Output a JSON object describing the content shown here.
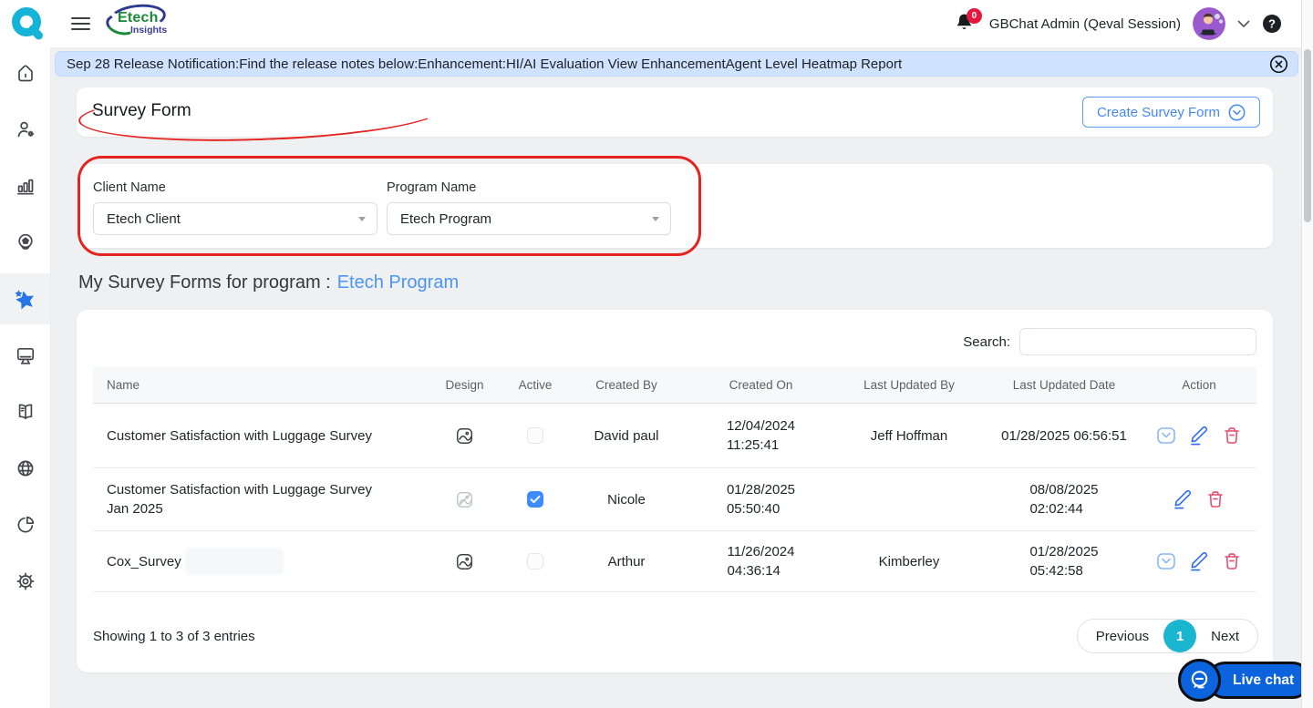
{
  "app": {
    "brand": {
      "line1": "Etech",
      "line2": "Insights"
    },
    "notification_badge": "0",
    "user_name": "GBChat Admin (Qeval Session)"
  },
  "banner": {
    "text": "Sep 28 Release Notification:Find the release notes below:Enhancement:HI/AI Evaluation View EnhancementAgent Level Heatmap Report"
  },
  "page": {
    "title": "Survey Form",
    "create_button": "Create Survey Form"
  },
  "filters": {
    "client": {
      "label": "Client Name",
      "value": "Etech Client"
    },
    "program": {
      "label": "Program Name",
      "value": "Etech Program"
    }
  },
  "section_heading": {
    "prefix": "My Survey Forms for program :",
    "program": "Etech Program"
  },
  "table": {
    "search_label": "Search:",
    "search_value": "",
    "columns": [
      "Name",
      "Design",
      "Active",
      "Created By",
      "Created On",
      "Last Updated By",
      "Last Updated Date",
      "Action"
    ],
    "rows": [
      {
        "name": "Customer Satisfaction with Luggage Survey",
        "active": false,
        "created_by": "David paul",
        "created_on_line1": "12/04/2024",
        "created_on_line2": "11:25:41",
        "last_updated_by": "Jeff Hoffman",
        "last_updated_line1": "01/28/2025 06:56:51",
        "last_updated_line2": "",
        "actions": [
          "mail",
          "edit",
          "delete"
        ],
        "design_disabled": false
      },
      {
        "name": "Customer Satisfaction with Luggage Survey Jan 2025",
        "active": true,
        "created_by": "Nicole",
        "created_on_line1": "01/28/2025",
        "created_on_line2": "05:50:40",
        "last_updated_by": "",
        "last_updated_line1": "08/08/2025",
        "last_updated_line2": "02:02:44",
        "actions": [
          "edit",
          "delete"
        ],
        "design_disabled": true
      },
      {
        "name": "Cox_Survey",
        "active": false,
        "created_by": "Arthur",
        "created_on_line1": "11/26/2024",
        "created_on_line2": "04:36:14",
        "last_updated_by": "Kimberley",
        "last_updated_line1": "01/28/2025",
        "last_updated_line2": "05:42:58",
        "actions": [
          "mail",
          "edit",
          "delete"
        ],
        "design_disabled": false
      }
    ],
    "footer": "Showing 1 to 3 of 3 entries"
  },
  "pagination": {
    "previous": "Previous",
    "current_page": "1",
    "next": "Next"
  },
  "live_chat": {
    "label": "Live chat"
  },
  "sidebar": {
    "items": [
      {
        "icon": "home-icon",
        "active": false
      },
      {
        "icon": "user-settings-icon",
        "active": false
      },
      {
        "icon": "bar-chart-icon",
        "active": false
      },
      {
        "icon": "qa-badge-icon",
        "active": false
      },
      {
        "icon": "survey-star-icon",
        "active": true
      },
      {
        "icon": "monitor-icon",
        "active": false
      },
      {
        "icon": "book-icon",
        "active": false
      },
      {
        "icon": "globe-icon",
        "active": false
      },
      {
        "icon": "pie-chart-icon",
        "active": false
      },
      {
        "icon": "settings-icon",
        "active": false
      }
    ]
  },
  "icons": {
    "top": [
      "qeval-logo-icon",
      "hamburger-icon",
      "bell-icon",
      "chevron-down-icon",
      "help-circle-icon"
    ],
    "banner_close": "close-circle-icon",
    "create_dropdown": "chevron-down-circle-icon",
    "select_caret": "caret-down-icon",
    "row": [
      "image-icon",
      "mail-icon",
      "pencil-icon",
      "trash-icon"
    ],
    "live_chat": "chat-bubble-icon"
  },
  "colors": {
    "accent_blue": "#4587f0",
    "link_blue": "#4d94f5",
    "cyan_page": "#1ab5cf",
    "annotation_red": "#e52420",
    "banner_bg": "#cfe2ff",
    "checkbox_checked": "#3d8bfd",
    "edit_icon": "#2e6bf0",
    "delete_icon": "#e64d6e",
    "mail_icon": "#8ab6f8",
    "live_chat_blue": "#0b63dd",
    "sidebar_active_star": "#2574e8",
    "badge_red": "#e6173e"
  }
}
